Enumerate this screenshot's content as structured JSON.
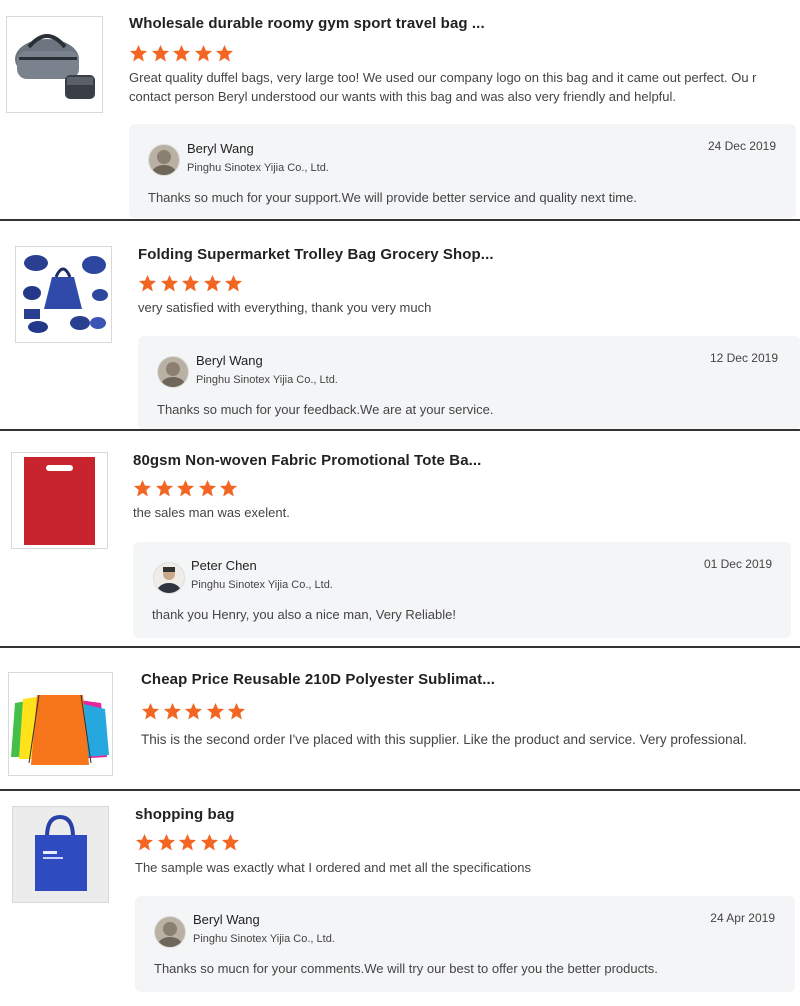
{
  "colors": {
    "star": "#f26522",
    "reply_bg": "#f4f5f7",
    "separator": "#333333"
  },
  "reviews": [
    {
      "product_title": "Wholesale durable roomy gym sport travel bag ...",
      "rating": 5,
      "comment": "Great quality duffel bags, very large too! We used our company logo on this bag and it came out perfect. Ou r contact person Beryl understood our wants with this bag and was also very friendly and helpful.",
      "reply": {
        "name": "Beryl Wang",
        "company": "Pinghu Sinotex Yijia Co., Ltd.",
        "date": "24 Dec 2019",
        "text": "Thanks so much for your support.We will provide better service and quality next time."
      }
    },
    {
      "product_title": "Folding Supermarket Trolley Bag Grocery Shop...",
      "rating": 5,
      "comment": "very satisfied with everything, thank you very much",
      "reply": {
        "name": "Beryl Wang",
        "company": "Pinghu Sinotex Yijia Co., Ltd.",
        "date": "12 Dec 2019",
        "text": "Thanks so much for your feedback.We are at your service."
      }
    },
    {
      "product_title": "80gsm Non-woven Fabric Promotional Tote Ba...",
      "rating": 5,
      "comment": "the sales man was exelent.",
      "reply": {
        "name": "Peter Chen",
        "company": "Pinghu Sinotex Yijia Co., Ltd.",
        "date": "01 Dec 2019",
        "text": "thank you Henry, you also a nice man, Very Reliable!"
      }
    },
    {
      "product_title": "Cheap Price Reusable 210D Polyester Sublimat...",
      "rating": 5,
      "comment": "This is the second order I've placed with this supplier. Like the product and service. Very professional."
    },
    {
      "product_title": "shopping bag",
      "rating": 5,
      "comment": "The sample was exactly what I ordered and met all the specifications",
      "reply": {
        "name": "Beryl Wang",
        "company": "Pinghu Sinotex Yijia Co., Ltd.",
        "date": "24 Apr 2019",
        "text": "Thanks so mucn for your comments.We will  try our best to offer you the better products."
      }
    }
  ]
}
